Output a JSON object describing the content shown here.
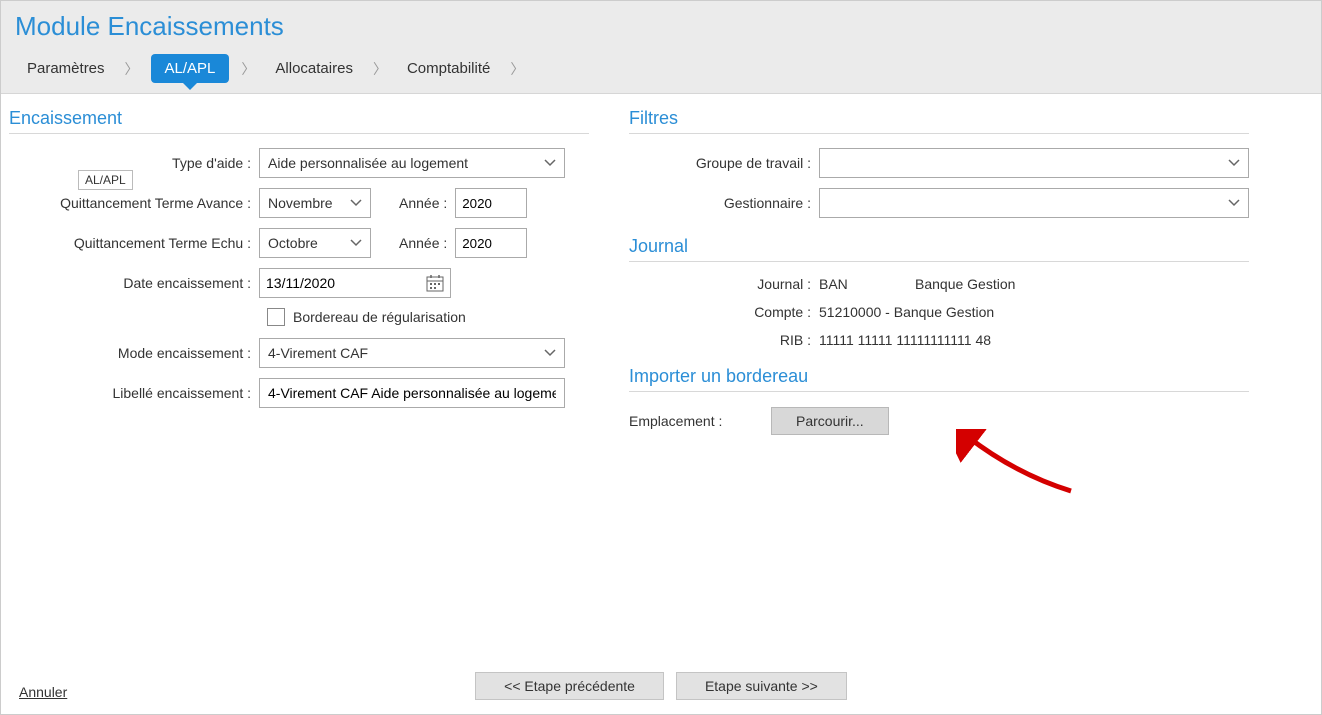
{
  "header": {
    "module_title": "Module Encaissements",
    "breadcrumb": {
      "parametres": "Paramètres",
      "al_apl": "AL/APL",
      "allocataires": "Allocataires",
      "comptabilite": "Comptabilité"
    },
    "tooltip": "AL/APL"
  },
  "encaissement": {
    "section_title": "Encaissement",
    "type_aide_label": "Type d'aide :",
    "type_aide_value": "Aide personnalisée au logement",
    "quit_avance_label": "Quittancement Terme Avance :",
    "quit_avance_month": "Novembre",
    "quit_avance_year_label": "Année :",
    "quit_avance_year": "2020",
    "quit_echu_label": "Quittancement Terme Echu :",
    "quit_echu_month": "Octobre",
    "quit_echu_year_label": "Année :",
    "quit_echu_year": "2020",
    "date_enc_label": "Date encaissement :",
    "date_enc_value": "13/11/2020",
    "bordereau_label": "Bordereau de régularisation",
    "mode_enc_label": "Mode encaissement :",
    "mode_enc_value": "4-Virement CAF",
    "libelle_enc_label": "Libellé encaissement :",
    "libelle_enc_value": "4-Virement CAF Aide personnalisée au logeme"
  },
  "filtres": {
    "section_title": "Filtres",
    "groupe_label": "Groupe de travail :",
    "gestionnaire_label": "Gestionnaire :"
  },
  "journal": {
    "section_title": "Journal",
    "journal_label": "Journal :",
    "journal_code": "BAN",
    "journal_name": "Banque Gestion",
    "compte_label": "Compte :",
    "compte_value": "51210000 - Banque Gestion",
    "rib_label": "RIB :",
    "rib_value": "11111 11111 11111111111 48"
  },
  "import": {
    "section_title": "Importer un bordereau",
    "emplacement_label": "Emplacement :",
    "parcourir_label": "Parcourir..."
  },
  "footer": {
    "cancel": "Annuler",
    "prev": "<< Etape précédente",
    "next": "Etape suivante >>"
  }
}
